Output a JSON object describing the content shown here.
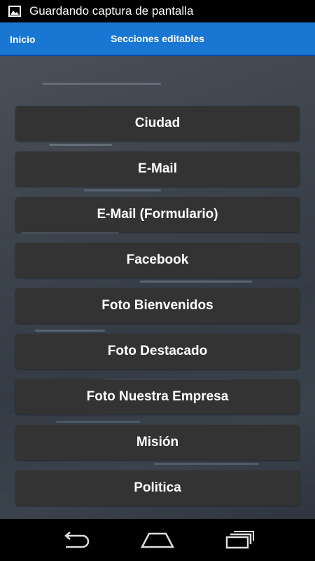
{
  "status_bar": {
    "notification_text": "Guardando captura de pantalla",
    "icon": "image-icon"
  },
  "app_bar": {
    "home_label": "Inicio",
    "title": "Secciones editables",
    "color": "#1976d2"
  },
  "menu": {
    "items": [
      {
        "label": "Ciudad"
      },
      {
        "label": "E-Mail"
      },
      {
        "label": "E-Mail (Formulario)"
      },
      {
        "label": "Facebook"
      },
      {
        "label": "Foto Bienvenidos"
      },
      {
        "label": "Foto Destacado"
      },
      {
        "label": "Foto Nuestra Empresa"
      },
      {
        "label": "Misión"
      },
      {
        "label": "Politica"
      }
    ]
  },
  "navigation": {
    "back_icon": "back-icon",
    "home_icon": "home-icon",
    "recents_icon": "recents-icon"
  }
}
